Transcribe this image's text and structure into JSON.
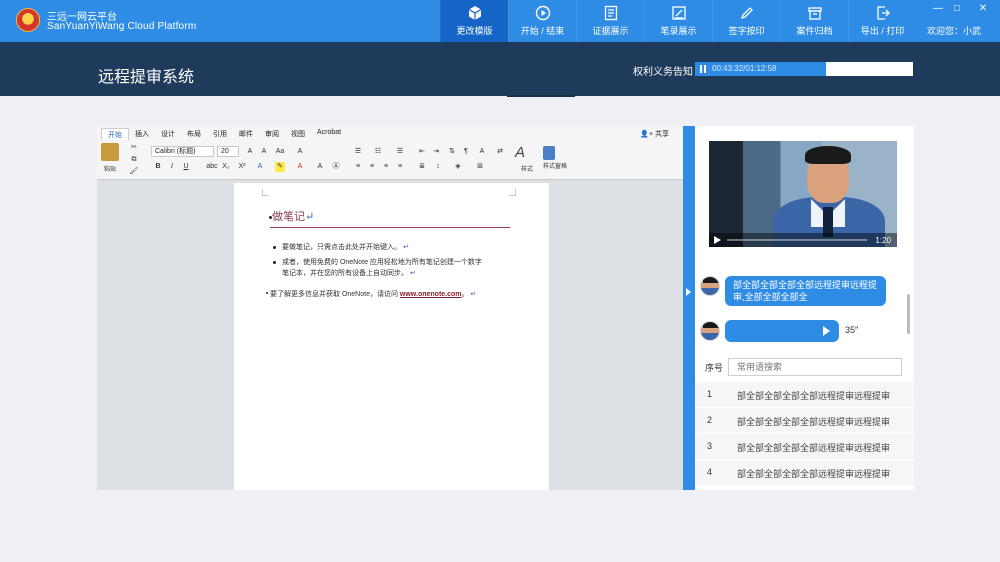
{
  "app": {
    "brand_line1": "三远一网云平台",
    "brand_line2": "SanYuanYiWang Cloud Platform",
    "welcome": "欢迎您：小武"
  },
  "nav": [
    {
      "label": "更改模版",
      "icon": "cube-icon",
      "active": true
    },
    {
      "label": "开始 / 结束",
      "icon": "play-circle-icon"
    },
    {
      "label": "证据展示",
      "icon": "document-icon"
    },
    {
      "label": "笔录展示",
      "icon": "note-icon"
    },
    {
      "label": "签字按印",
      "icon": "pen-icon"
    },
    {
      "label": "案件归档",
      "icon": "archive-icon"
    },
    {
      "label": "导出 / 打印",
      "icon": "export-icon"
    }
  ],
  "window_controls": {
    "minimize": "—",
    "restore": "□",
    "close": "✕"
  },
  "system_title": "远程提审系统",
  "audio": {
    "label": "权利义务告知",
    "time": "00:43:32/01:12:58",
    "progress": 0.6
  },
  "word": {
    "tabs": [
      "开始",
      "插入",
      "设计",
      "布局",
      "引用",
      "邮件",
      "审阅",
      "视图",
      "Acrobat"
    ],
    "share": "共享",
    "paste_label": "粘贴",
    "font_name": "Calibri (标题)",
    "font_size": "20",
    "styles_label": "样式",
    "pane_label": "样式窗格",
    "doc": {
      "title": "做笔记",
      "bullet1": "要做笔记，只需点击此处并开始键入。",
      "bullet2a": "或者，使用免费的 OneNote 应用轻松地为所有笔记创建一个数字",
      "bullet2b": "笔记本，并在您的所有设备上自动同步。",
      "footer_prefix": "要了解更多信息并获取 OneNote，请访问 ",
      "footer_link": "www.onenote.com",
      "footer_suffix": "。",
      "return_mark": "↵"
    }
  },
  "video": {
    "time": "1:20"
  },
  "chat": {
    "message1": "部全部全部全部全部远程提审远程提审,全部全部全部全",
    "voice_duration": "35″"
  },
  "phrases": {
    "header": "序号",
    "search_placeholder": "常用语搜索",
    "rows": [
      {
        "num": "1",
        "text": "部全部全部全部全部远程提审远程提审"
      },
      {
        "num": "2",
        "text": "部全部全部全部全部远程提审远程提审"
      },
      {
        "num": "3",
        "text": "部全部全部全部全部远程提审远程提审"
      },
      {
        "num": "4",
        "text": "部全部全部全部全部远程提审远程提审"
      }
    ]
  },
  "colors": {
    "primary": "#2f8ce5",
    "header_dark": "#1f3b5b",
    "active_nav": "#1565c7"
  }
}
